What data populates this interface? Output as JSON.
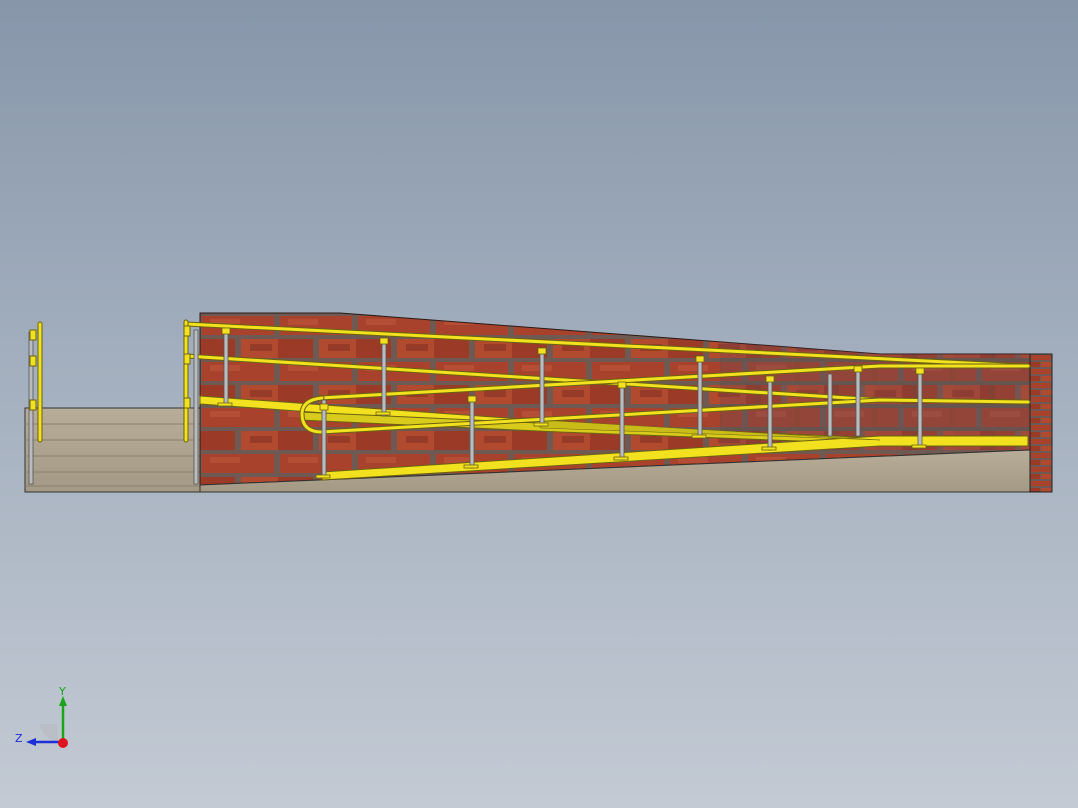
{
  "viewport": {
    "background_top": "#8796aa",
    "background_bottom": "#c3cad4"
  },
  "model": {
    "rail_color": "#f2e11e",
    "rail_edge_color": "#6b6210",
    "post_color": "#b9bbbc",
    "brick_color": "#a8422c",
    "mortar_color": "#6e5a52",
    "floor_color": "#aaa08c"
  },
  "triad": {
    "y_label": "Y",
    "z_label": "Z",
    "y_color": "#1aa51a",
    "z_color": "#1c2fd8",
    "x_color": "#e0141c"
  }
}
